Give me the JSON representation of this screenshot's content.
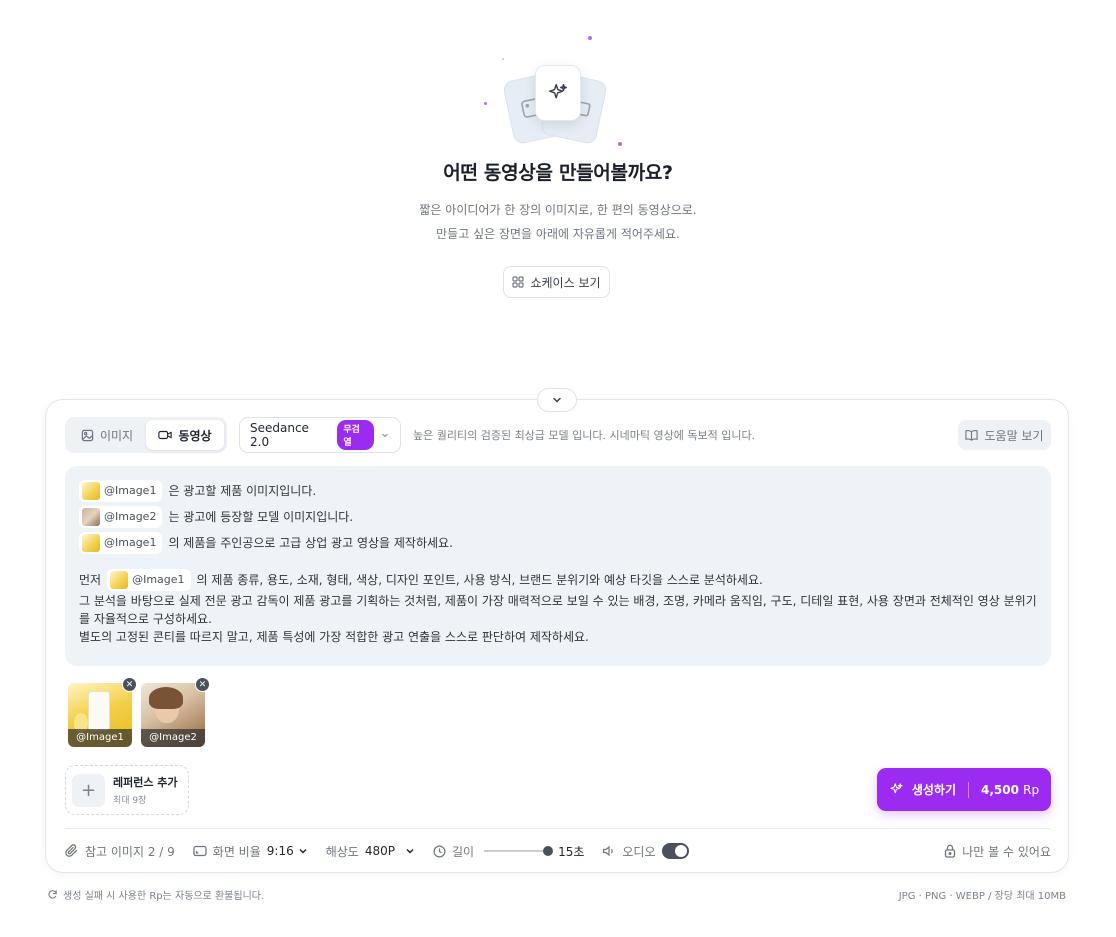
{
  "hero": {
    "title": "어떤 동영상을 만들어볼까요?",
    "subtitle_line1": "짧은 아이디어가 한 장의 이미지로, 한 편의 동영상으로.",
    "subtitle_line2": "만들고 싶은 장면을 아래에 자유롭게 적어주세요.",
    "showcase_label": "쇼케이스 보기"
  },
  "mode_tabs": [
    {
      "label": "이미지",
      "active": false
    },
    {
      "label": "동영상",
      "active": true
    }
  ],
  "model": {
    "name": "Seedance 2.0",
    "badge": "무검열",
    "description": "높은 퀄리티의 검증된 최상급 모델 입니다. 시네마틱 영상에 독보적 입니다."
  },
  "help_label": "도움말 보기",
  "prompt": {
    "line1_tag": "@Image1",
    "line1_text": "은 광고할 제품 이미지입니다.",
    "line2_tag": "@Image2",
    "line2_text": "는 광고에 등장할 모델 이미지입니다.",
    "line3_tag": "@Image1",
    "line3_text": "의 제품을 주인공으로 고급 상업 광고 영상을 제작하세요.",
    "para_prefix": "먼저",
    "para_tag": "@Image1",
    "para_text": "의 제품 종류, 용도, 소재, 형태, 색상, 디자인 포인트, 사용 방식, 브랜드 분위기와 예상 타깃을 스스로 분석하세요.",
    "para_line2": "그 분석을 바탕으로 실제 전문 광고 감독이 제품 광고를 기획하는 것처럼, 제품이 가장 매력적으로 보일 수 있는 배경, 조명, 카메라 움직임, 구도, 디테일 표현, 사용 장면과 전체적인 영상 분위기를 자율적으로 구성하세요.",
    "para_line3": "별도의 고정된 콘티를 따르지 말고, 제품 특성에 가장 적합한 광고 연출을 스스로 판단하여 제작하세요."
  },
  "attachments": [
    {
      "label": "@Image1"
    },
    {
      "label": "@Image2"
    }
  ],
  "reference": {
    "title": "레퍼런스 추가",
    "sub": "최대 9장"
  },
  "generate": {
    "label": "생성하기",
    "price": "4,500",
    "unit": "Rp"
  },
  "settings": {
    "ref_label": "참고 이미지 2 / 9",
    "ratio_label": "화면 비율",
    "ratio_value": "9:16",
    "resolution_label": "해상도",
    "resolution_value": "480P",
    "length_label": "길이",
    "length_value": "15초",
    "length_fraction": 1.0,
    "audio_label": "오디오",
    "audio_on": true,
    "private_label": "나만 볼 수 있어요"
  },
  "footer": {
    "refund_note": "생성 실패 시 사용한 Rp는 자동으로 환불됩니다.",
    "file_note": "JPG · PNG · WEBP / 장당 최대 10MB"
  },
  "colors": {
    "accent": "#9b2bf0",
    "prompt_bg": "#eef3f8"
  }
}
